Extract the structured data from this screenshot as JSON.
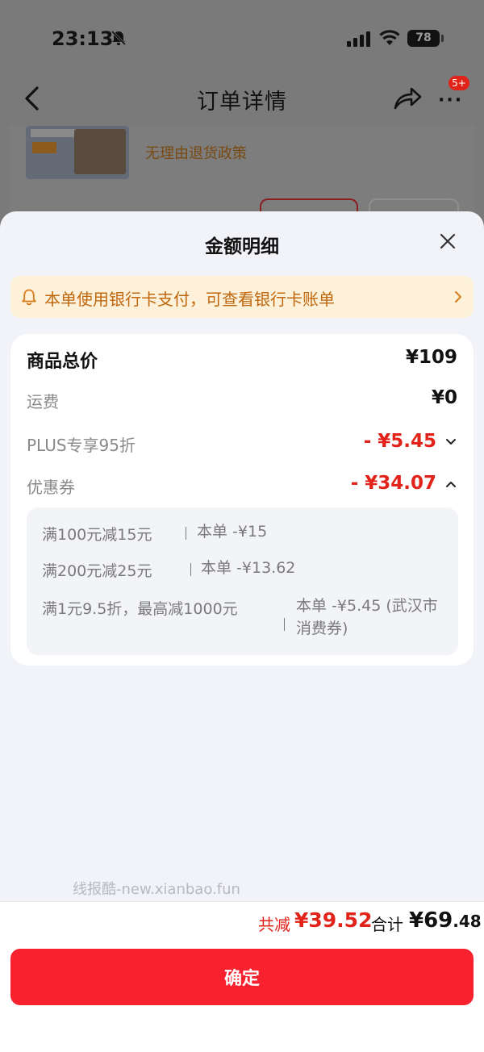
{
  "status_bar": {
    "time": "23:13",
    "battery": "78"
  },
  "nav": {
    "title": "订单详情",
    "badge": "5+"
  },
  "background_card": {
    "return_policy": "无理由退货政策"
  },
  "sheet": {
    "title": "金额明细",
    "notice": "本单使用银行卡支付，可查看银行卡账单",
    "rows": {
      "total": {
        "label": "商品总价",
        "value": "¥109"
      },
      "shipping": {
        "label": "运费",
        "value": "¥0"
      },
      "plus": {
        "label": "PLUS专享95折",
        "value": "- ¥5.45"
      },
      "coupon": {
        "label": "优惠券",
        "value": "- ¥34.07"
      }
    },
    "coupons": [
      {
        "rule": "满100元减15元",
        "amount": "本单 -¥15"
      },
      {
        "rule": "满200元减25元",
        "amount": "本单 -¥13.62"
      },
      {
        "rule": "满1元9.5折，最高减1000元",
        "amount": "本单 -¥5.45 (武汉市消费券)"
      }
    ]
  },
  "watermark": "线报酷-new.xianbao.fun",
  "footer": {
    "saving_label": "共减",
    "saving_value": "¥39.52",
    "total_label": "合计",
    "total_value": "¥69",
    "total_decimal": ".48",
    "confirm_label": "确定"
  },
  "colors": {
    "accent_red": "#e2231a",
    "button_red": "#f7222e",
    "notice_bg": "#fdf1d9",
    "notice_text": "#c0670e"
  }
}
